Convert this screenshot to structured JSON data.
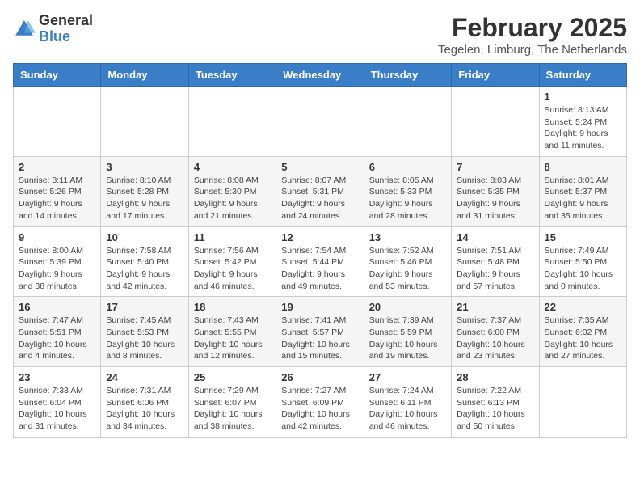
{
  "header": {
    "logo_general": "General",
    "logo_blue": "Blue",
    "month_title": "February 2025",
    "location": "Tegelen, Limburg, The Netherlands"
  },
  "weekdays": [
    "Sunday",
    "Monday",
    "Tuesday",
    "Wednesday",
    "Thursday",
    "Friday",
    "Saturday"
  ],
  "weeks": [
    [
      {
        "day": "",
        "info": ""
      },
      {
        "day": "",
        "info": ""
      },
      {
        "day": "",
        "info": ""
      },
      {
        "day": "",
        "info": ""
      },
      {
        "day": "",
        "info": ""
      },
      {
        "day": "",
        "info": ""
      },
      {
        "day": "1",
        "info": "Sunrise: 8:13 AM\nSunset: 5:24 PM\nDaylight: 9 hours and 11 minutes."
      }
    ],
    [
      {
        "day": "2",
        "info": "Sunrise: 8:11 AM\nSunset: 5:26 PM\nDaylight: 9 hours and 14 minutes."
      },
      {
        "day": "3",
        "info": "Sunrise: 8:10 AM\nSunset: 5:28 PM\nDaylight: 9 hours and 17 minutes."
      },
      {
        "day": "4",
        "info": "Sunrise: 8:08 AM\nSunset: 5:30 PM\nDaylight: 9 hours and 21 minutes."
      },
      {
        "day": "5",
        "info": "Sunrise: 8:07 AM\nSunset: 5:31 PM\nDaylight: 9 hours and 24 minutes."
      },
      {
        "day": "6",
        "info": "Sunrise: 8:05 AM\nSunset: 5:33 PM\nDaylight: 9 hours and 28 minutes."
      },
      {
        "day": "7",
        "info": "Sunrise: 8:03 AM\nSunset: 5:35 PM\nDaylight: 9 hours and 31 minutes."
      },
      {
        "day": "8",
        "info": "Sunrise: 8:01 AM\nSunset: 5:37 PM\nDaylight: 9 hours and 35 minutes."
      }
    ],
    [
      {
        "day": "9",
        "info": "Sunrise: 8:00 AM\nSunset: 5:39 PM\nDaylight: 9 hours and 38 minutes."
      },
      {
        "day": "10",
        "info": "Sunrise: 7:58 AM\nSunset: 5:40 PM\nDaylight: 9 hours and 42 minutes."
      },
      {
        "day": "11",
        "info": "Sunrise: 7:56 AM\nSunset: 5:42 PM\nDaylight: 9 hours and 46 minutes."
      },
      {
        "day": "12",
        "info": "Sunrise: 7:54 AM\nSunset: 5:44 PM\nDaylight: 9 hours and 49 minutes."
      },
      {
        "day": "13",
        "info": "Sunrise: 7:52 AM\nSunset: 5:46 PM\nDaylight: 9 hours and 53 minutes."
      },
      {
        "day": "14",
        "info": "Sunrise: 7:51 AM\nSunset: 5:48 PM\nDaylight: 9 hours and 57 minutes."
      },
      {
        "day": "15",
        "info": "Sunrise: 7:49 AM\nSunset: 5:50 PM\nDaylight: 10 hours and 0 minutes."
      }
    ],
    [
      {
        "day": "16",
        "info": "Sunrise: 7:47 AM\nSunset: 5:51 PM\nDaylight: 10 hours and 4 minutes."
      },
      {
        "day": "17",
        "info": "Sunrise: 7:45 AM\nSunset: 5:53 PM\nDaylight: 10 hours and 8 minutes."
      },
      {
        "day": "18",
        "info": "Sunrise: 7:43 AM\nSunset: 5:55 PM\nDaylight: 10 hours and 12 minutes."
      },
      {
        "day": "19",
        "info": "Sunrise: 7:41 AM\nSunset: 5:57 PM\nDaylight: 10 hours and 15 minutes."
      },
      {
        "day": "20",
        "info": "Sunrise: 7:39 AM\nSunset: 5:59 PM\nDaylight: 10 hours and 19 minutes."
      },
      {
        "day": "21",
        "info": "Sunrise: 7:37 AM\nSunset: 6:00 PM\nDaylight: 10 hours and 23 minutes."
      },
      {
        "day": "22",
        "info": "Sunrise: 7:35 AM\nSunset: 6:02 PM\nDaylight: 10 hours and 27 minutes."
      }
    ],
    [
      {
        "day": "23",
        "info": "Sunrise: 7:33 AM\nSunset: 6:04 PM\nDaylight: 10 hours and 31 minutes."
      },
      {
        "day": "24",
        "info": "Sunrise: 7:31 AM\nSunset: 6:06 PM\nDaylight: 10 hours and 34 minutes."
      },
      {
        "day": "25",
        "info": "Sunrise: 7:29 AM\nSunset: 6:07 PM\nDaylight: 10 hours and 38 minutes."
      },
      {
        "day": "26",
        "info": "Sunrise: 7:27 AM\nSunset: 6:09 PM\nDaylight: 10 hours and 42 minutes."
      },
      {
        "day": "27",
        "info": "Sunrise: 7:24 AM\nSunset: 6:11 PM\nDaylight: 10 hours and 46 minutes."
      },
      {
        "day": "28",
        "info": "Sunrise: 7:22 AM\nSunset: 6:13 PM\nDaylight: 10 hours and 50 minutes."
      },
      {
        "day": "",
        "info": ""
      }
    ]
  ]
}
